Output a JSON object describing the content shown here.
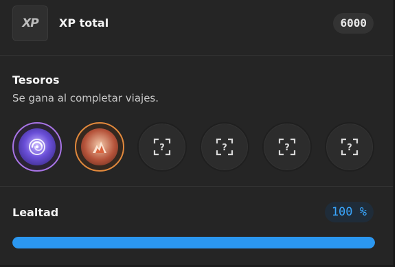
{
  "xp": {
    "logo_text": "XP",
    "title": "XP total",
    "value": "6000"
  },
  "treasures": {
    "title": "Tesoros",
    "subtitle": "Se gana al completar viajes.",
    "badges": [
      {
        "state": "unlocked",
        "icon": "swirl-orb-icon",
        "color": "#a874e6"
      },
      {
        "state": "unlocked",
        "icon": "flame-mountain-icon",
        "color": "#e2893c"
      },
      {
        "state": "locked",
        "icon": "unknown-scan-icon"
      },
      {
        "state": "locked",
        "icon": "unknown-scan-icon"
      },
      {
        "state": "locked",
        "icon": "unknown-scan-icon"
      },
      {
        "state": "locked",
        "icon": "unknown-scan-icon"
      }
    ]
  },
  "loyalty": {
    "title": "Lealtad",
    "value": "100 %",
    "progress": 1.0,
    "accent": "#2b97f0"
  }
}
